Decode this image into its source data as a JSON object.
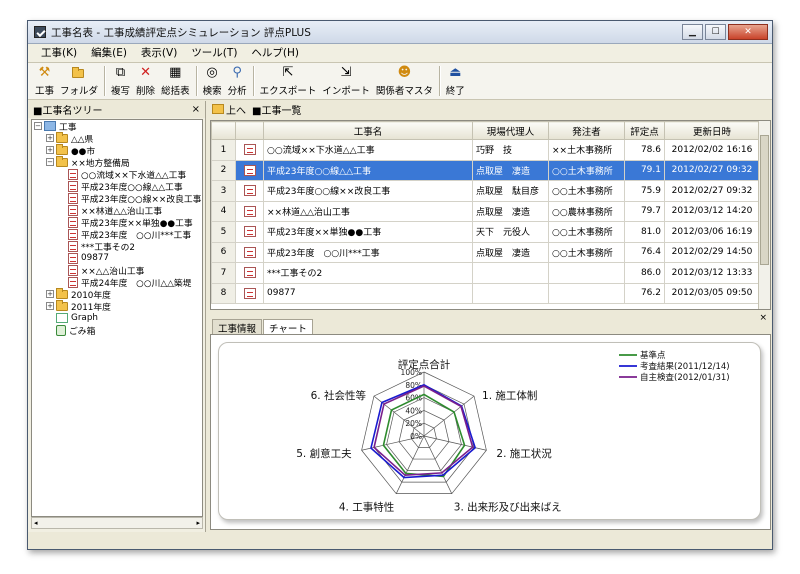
{
  "window": {
    "title": "工事名表 - 工事成績評定点シミュレーション 評点PLUS"
  },
  "menu": [
    "工事(K)",
    "編集(E)",
    "表示(V)",
    "ツール(T)",
    "ヘルプ(H)"
  ],
  "toolbar": {
    "koji": "工事",
    "folder": "フォルダ",
    "copy": "複写",
    "delete": "削除",
    "summary": "総括表",
    "search": "検索",
    "analyze": "分析",
    "export": "エクスポート",
    "import": "インポート",
    "persons": "関係者マスタ",
    "exit": "終了"
  },
  "tree_panel": {
    "title": "■工事名ツリー",
    "close": "×"
  },
  "tree": {
    "root": "工事",
    "items": [
      "△△県",
      "●●市",
      "××地方整備局",
      "○○流域××下水道△△工事",
      "平成23年度○○線△△工事",
      "平成23年度○○線××改良工事",
      "××林道△△治山工事",
      "平成23年度××単独●●工事",
      "平成23年度　○○川***工事",
      "***工事その2",
      "09877",
      "××△△治山工事",
      "平成24年度　○○川△△築堤",
      "2010年度",
      "2011年度",
      "Graph",
      "ごみ箱"
    ]
  },
  "nav": {
    "up": "上へ",
    "list": "■工事一覧"
  },
  "table": {
    "headers": [
      "",
      "",
      "工事名",
      "現場代理人",
      "発注者",
      "評定点",
      "更新日時"
    ],
    "rows": [
      {
        "no": "1",
        "name": "○○流域××下水道△△工事",
        "agent": "巧野　技",
        "client": "××土木事務所",
        "score": "78.6",
        "updated": "2012/02/02 16:16"
      },
      {
        "no": "2",
        "name": "平成23年度○○線△△工事",
        "agent": "点取屋　凄造",
        "client": "○○土木事務所",
        "score": "79.1",
        "updated": "2012/02/27 09:32"
      },
      {
        "no": "3",
        "name": "平成23年度○○線××改良工事",
        "agent": "点取屋　駄目彦",
        "client": "○○土木事務所",
        "score": "75.9",
        "updated": "2012/02/27 09:32"
      },
      {
        "no": "4",
        "name": "××林道△△治山工事",
        "agent": "点取屋　凄造",
        "client": "○○農林事務所",
        "score": "79.7",
        "updated": "2012/03/12 14:20"
      },
      {
        "no": "5",
        "name": "平成23年度××単独●●工事",
        "agent": "天下　元役人",
        "client": "○○土木事務所",
        "score": "81.0",
        "updated": "2012/03/06 16:19"
      },
      {
        "no": "6",
        "name": "平成23年度　○○川***工事",
        "agent": "点取屋　凄造",
        "client": "○○土木事務所",
        "score": "76.4",
        "updated": "2012/02/29 14:50"
      },
      {
        "no": "7",
        "name": "***工事その2",
        "agent": "",
        "client": "",
        "score": "86.0",
        "updated": "2012/03/12 13:33"
      },
      {
        "no": "8",
        "name": "09877",
        "agent": "",
        "client": "",
        "score": "76.2",
        "updated": "2012/03/05 09:50"
      }
    ]
  },
  "bottom": {
    "close": "×",
    "tabs": [
      "工事情報",
      "チャート"
    ]
  },
  "chart_data": {
    "type": "radar",
    "title": "評定点合計",
    "axes": [
      "評定点合計",
      "1. 施工体制",
      "2. 施工状況",
      "3. 出来形及び出来ばえ",
      "4. 工事特性",
      "5. 創意工夫",
      "6. 社会性等"
    ],
    "ticks": [
      "100%",
      "80%",
      "60%",
      "40%",
      "20%",
      "0%"
    ],
    "max": 100,
    "series": [
      {
        "name": "基準点",
        "color": "#2e8b2e",
        "values": [
          65,
          60,
          65,
          70,
          65,
          65,
          65
        ]
      },
      {
        "name": "考査結果(2011/12/14)",
        "color": "#1a1ad0",
        "values": [
          80,
          75,
          82,
          68,
          72,
          85,
          84
        ]
      },
      {
        "name": "自主検査(2012/01/31)",
        "color": "#7a1f8c",
        "values": [
          78,
          74,
          78,
          64,
          68,
          80,
          80
        ]
      }
    ]
  }
}
